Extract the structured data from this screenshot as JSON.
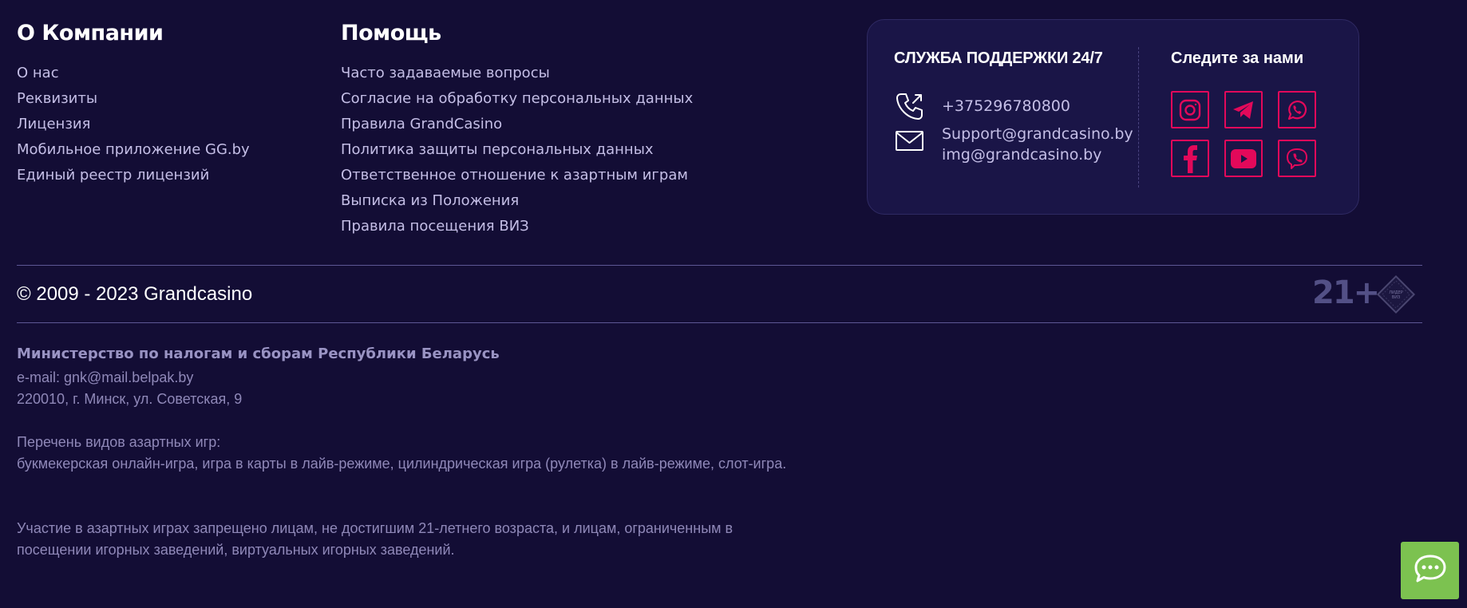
{
  "about": {
    "title": "О Компании",
    "links": [
      "О нас",
      "Реквизиты",
      "Лицензия",
      "Мобильное приложение GG.by",
      "Единый реестр лицензий"
    ]
  },
  "help": {
    "title": "Помощь",
    "links": [
      "Часто задаваемые вопросы",
      "Согласие на обработку персональных данных",
      "Правила GrandCasino",
      "Политика защиты персональных данных",
      "Ответственное отношение к азартным играм",
      "Выписка из Положения",
      "Правила посещения ВИЗ"
    ]
  },
  "support": {
    "title": "СЛУЖБА ПОДДЕРЖКИ 24/7",
    "phone": "+375296780800",
    "emails": [
      "Support@grandcasino.by",
      "img@grandcasino.by"
    ],
    "phone_icon": "phone-icon",
    "mail_icon": "envelope-icon"
  },
  "social": {
    "title": "Следите за нами",
    "icons": [
      "instagram-icon",
      "telegram-icon",
      "whatsapp-icon",
      "facebook-icon",
      "youtube-icon",
      "viber-icon"
    ],
    "accent_color": "#e3095a"
  },
  "footer": {
    "copyright": "© 2009 - 2023 Grandcasino",
    "age_badge": "21+",
    "leader_logo_text": "ЛИДЕР ВИЗ"
  },
  "legal": {
    "ministry_title": "Министерство по налогам и сборам Республики Беларусь",
    "ministry_email": "e-mail: gnk@mail.belpak.by",
    "ministry_address": "220010, г. Минск, ул. Советская, 9",
    "games_title": "Перечень видов азартных игр:",
    "games_list": "букмекерская онлайн-игра, игра в карты в лайв-режиме, цилиндрическая игра (рулетка) в лайв-режиме, слот-игра.",
    "age_restriction": "Участие в азартных играх запрещено лицам, не достигшим 21-летнего возраста, и лицам, ограниченным в посещении игорных заведений, виртуальных игорных заведений."
  },
  "chat": {
    "icon": "chat-icon",
    "color": "#7cc250"
  },
  "colors": {
    "background": "#130d35",
    "card": "#1a1547"
  }
}
